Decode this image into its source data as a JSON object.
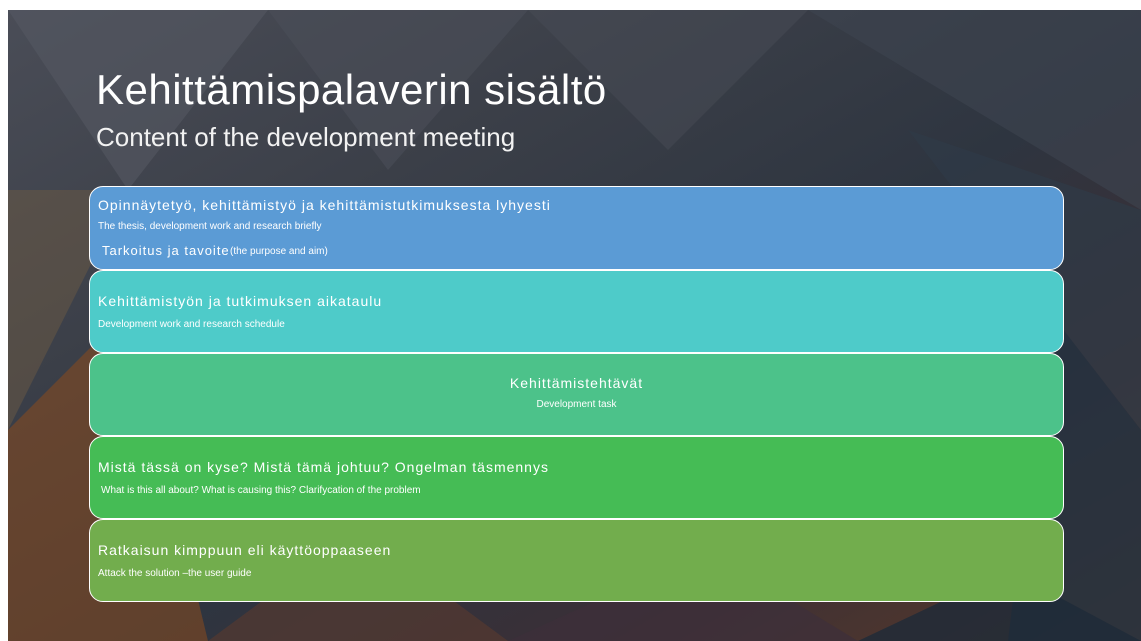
{
  "slide": {
    "title": "Kehittämispalaverin sisältö",
    "subtitle": "Content of the development meeting"
  },
  "items": [
    {
      "main": "Opinnäytetyö, kehittämistyö ja kehittämistutkimuksesta lyhyesti",
      "sub": "The thesis, development work and research briefly",
      "extra": "Tarkoitus ja tavoite",
      "extra_sub": "(the purpose and aim)",
      "color": "#5b9bd5"
    },
    {
      "main": "Kehittämistyön ja tutkimuksen aikataulu",
      "sub": "Development work and research schedule",
      "color": "#4ecbc9"
    },
    {
      "main": "Kehittämistehtävät",
      "sub": "Development task",
      "color": "#4cc28a"
    },
    {
      "main": "Mistä tässä on kyse? Mistä tämä johtuu? Ongelman täsmennys",
      "sub": "What is this all about? What is causing this? Clarifycation of the problem",
      "color": "#45bc55"
    },
    {
      "main": "Ratkaisun kimppuun eli käyttöoppaaseen",
      "sub": "Attack the solution –the user guide",
      "color": "#72ad4d"
    }
  ]
}
